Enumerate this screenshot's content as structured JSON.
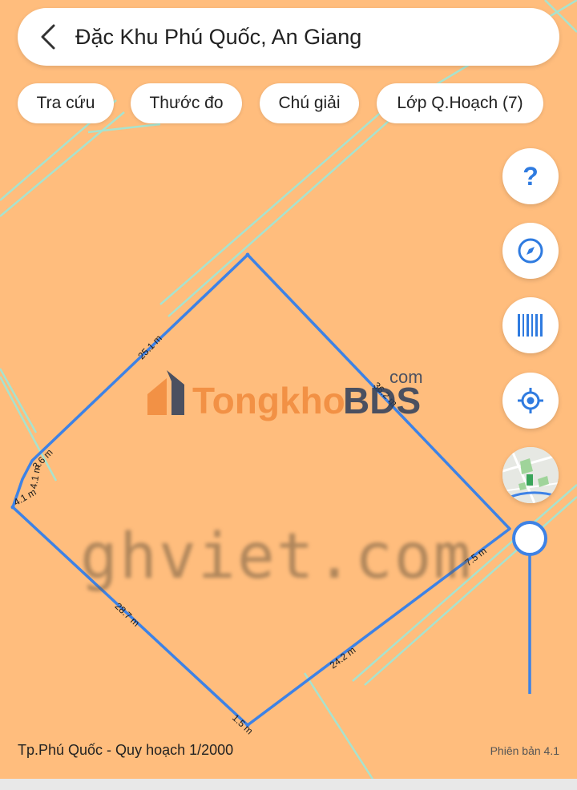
{
  "search": {
    "title": "Đặc Khu Phú Quốc, An Giang"
  },
  "chips": [
    {
      "label": "Tra cứu"
    },
    {
      "label": "Thước đo"
    },
    {
      "label": "Chú giải"
    },
    {
      "label": "Lớp Q.Hoạch (7)"
    }
  ],
  "tools": {
    "help": "?",
    "compass": "compass-icon",
    "barcode": "barcode-icon",
    "locate": "locate-icon",
    "layer": "map-thumbnail-icon"
  },
  "plot": {
    "edges": [
      {
        "label": "25.1 m"
      },
      {
        "label": "36.2 m"
      },
      {
        "label": "7.5 m"
      },
      {
        "label": "24.2 m"
      },
      {
        "label": "1.5 m"
      },
      {
        "label": "28.7 m"
      },
      {
        "label": "4.1 m"
      },
      {
        "label": "4.1 m"
      },
      {
        "label": "3.6 m"
      }
    ],
    "line_color": "#3d82e6",
    "road_color": "#a7e3cf"
  },
  "watermarks": {
    "logo_main": "Tongkho",
    "logo_accent": "BDS",
    "logo_sup": "com",
    "text": "ghviet.com"
  },
  "footer": {
    "left": "Tp.Phú Quốc - Quy hoạch 1/2000",
    "right": "Phiên bản 4.1"
  }
}
